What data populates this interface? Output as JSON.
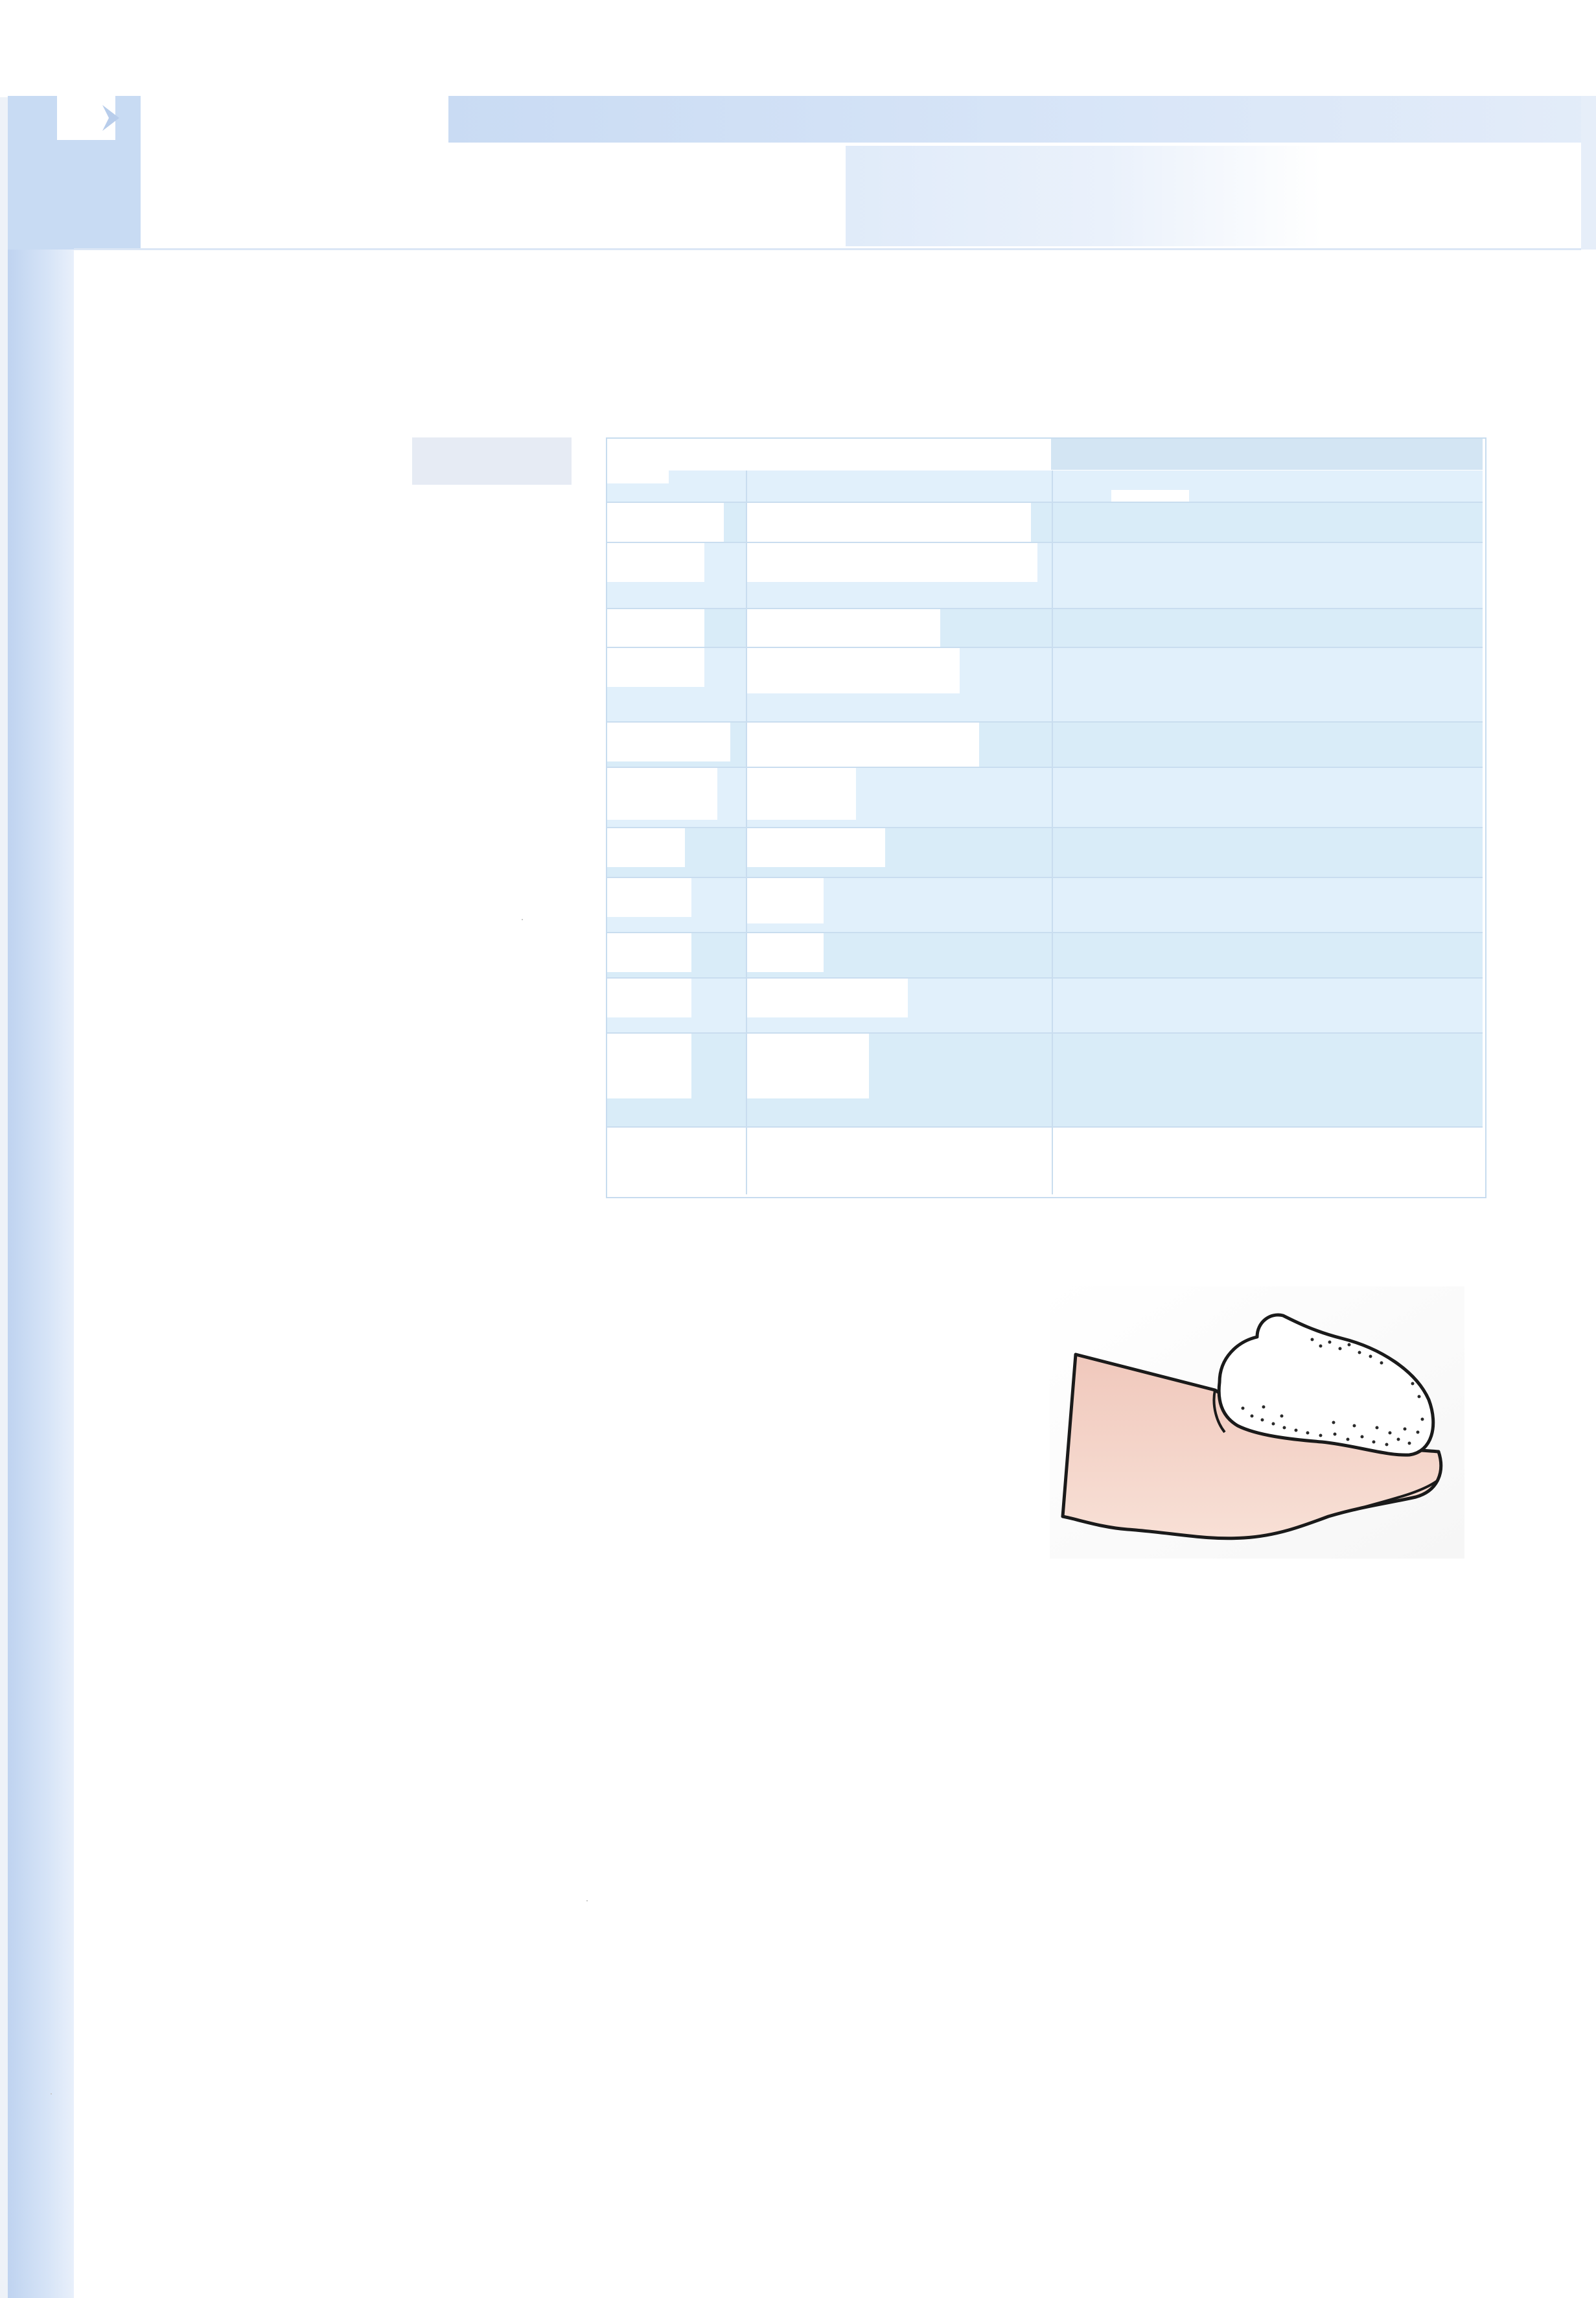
{
  "header": {
    "corner_icon": "chevron-right-icon",
    "title": "",
    "subtitle": ""
  },
  "side_label": "",
  "table": {
    "header": [
      "",
      "",
      ""
    ],
    "rows": [
      [
        "",
        "",
        ""
      ],
      [
        "",
        "",
        ""
      ],
      [
        "",
        "",
        ""
      ],
      [
        "",
        "",
        ""
      ],
      [
        "",
        "",
        ""
      ],
      [
        "",
        "",
        ""
      ],
      [
        "",
        "",
        ""
      ],
      [
        "",
        "",
        ""
      ],
      [
        "",
        "",
        ""
      ],
      [
        "",
        "",
        ""
      ],
      [
        "",
        "",
        ""
      ],
      [
        "",
        "",
        ""
      ]
    ]
  },
  "illustration": {
    "icon": "fingertip-with-foam-icon",
    "colors": {
      "skin": "#f4d4c8",
      "foam": "#ffffff",
      "outline": "#1a1a1a"
    }
  },
  "colors": {
    "band": "#c9dbf3",
    "table_fill": "#e1f0fb",
    "table_rule": "#c9ddef"
  }
}
